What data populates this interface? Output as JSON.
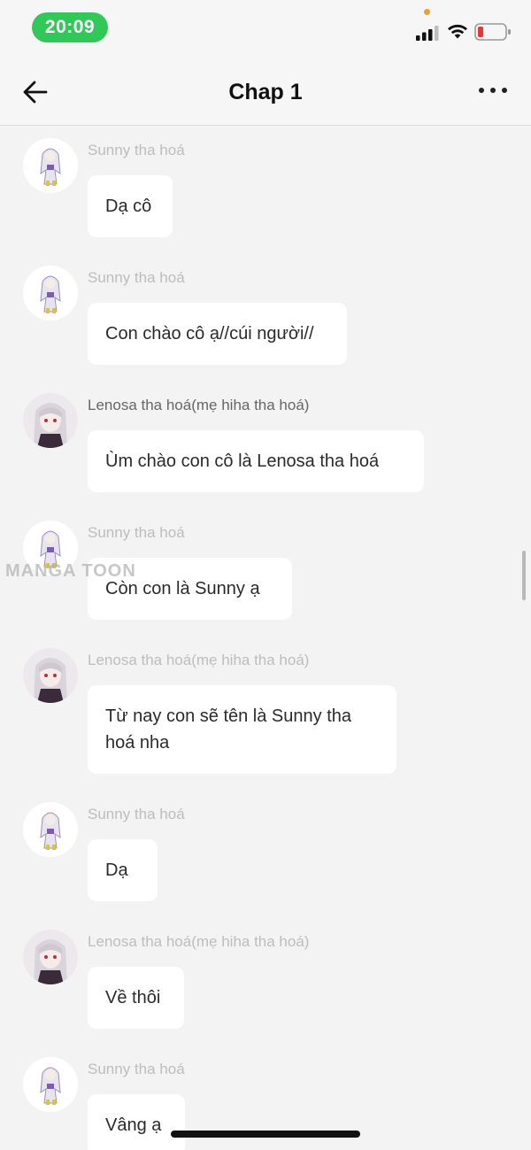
{
  "status_bar": {
    "time": "20:09"
  },
  "header": {
    "title": "Chap 1"
  },
  "watermark": "MANGA TOON",
  "messages": [
    {
      "sender": "Sunny tha hoá",
      "text": "Dạ cô",
      "avatar": "sunny-avatar"
    },
    {
      "sender": "Sunny tha hoá",
      "text": "Con chào cô ạ//cúi người//",
      "avatar": "sunny-avatar"
    },
    {
      "sender": "Lenosa tha hoá(mẹ hiha tha hoá)",
      "text": "Ùm chào con cô là Lenosa tha hoá",
      "avatar": "lenosa-avatar"
    },
    {
      "sender": "Sunny tha hoá",
      "text": "Còn con là Sunny ạ",
      "avatar": "sunny-avatar"
    },
    {
      "sender": "Lenosa tha hoá(mẹ hiha tha hoá)",
      "text": "Từ nay con sẽ tên là Sunny tha hoá nha",
      "avatar": "lenosa-avatar"
    },
    {
      "sender": "Sunny tha hoá",
      "text": "Dạ",
      "avatar": "sunny-avatar"
    },
    {
      "sender": "Lenosa tha hoá(mẹ hiha tha hoá)",
      "text": "Về thôi",
      "avatar": "lenosa-avatar"
    },
    {
      "sender": "Sunny tha hoá",
      "text": "Vâng ạ",
      "avatar": "sunny-avatar"
    }
  ],
  "colors": {
    "time_pill": "#31c759",
    "background": "#f3f3f3",
    "bubble": "#ffffff",
    "sender_name": "#bdbdbd"
  }
}
